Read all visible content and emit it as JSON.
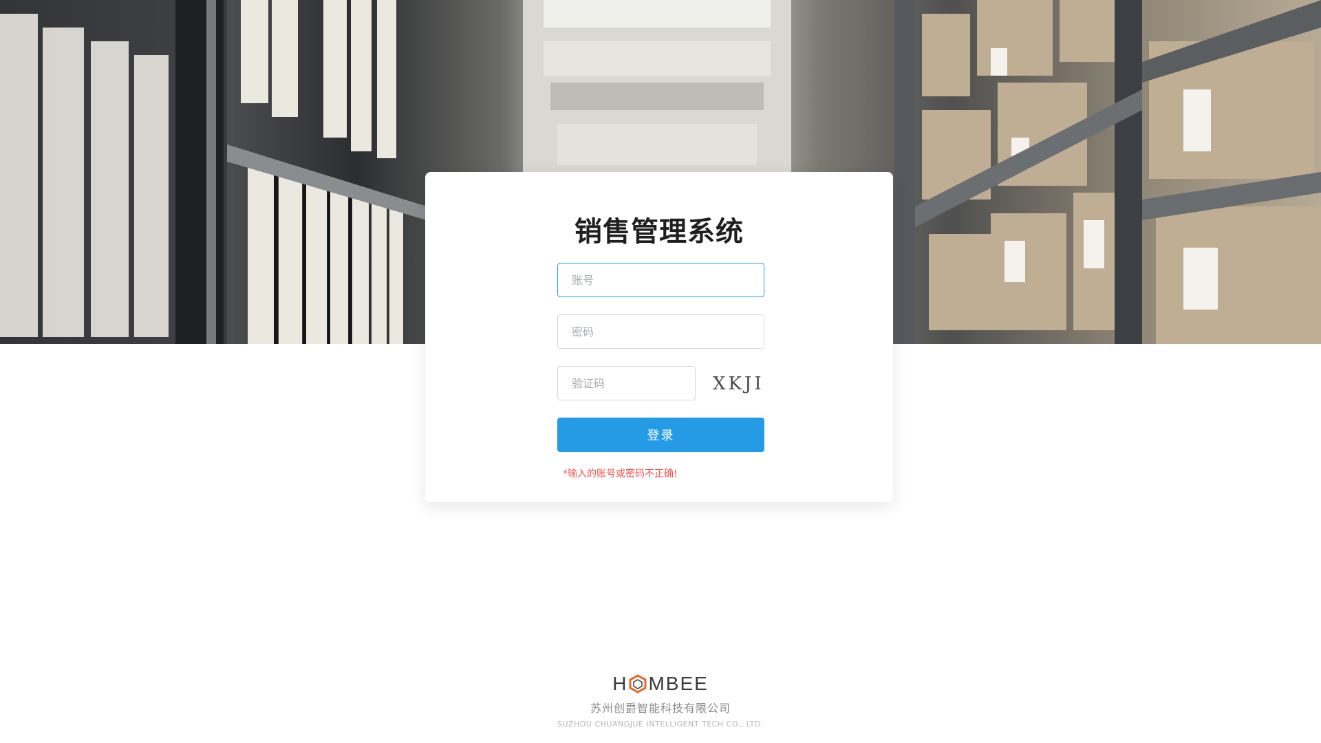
{
  "login": {
    "title": "销售管理系统",
    "account_placeholder": "账号",
    "password_placeholder": "密码",
    "captcha_placeholder": "验证码",
    "captcha_text": "XKJI",
    "submit_label": "登录",
    "error_message": "*输入的账号或密码不正确!"
  },
  "footer": {
    "brand_prefix": "H",
    "brand_suffix": "MBEE",
    "brand_mark_text": "O",
    "company_cn": "苏州创爵智能科技有限公司",
    "company_en": "SUZHOU CHUANGJUE INTELLIGENT TECH CO., LTD."
  },
  "colors": {
    "accent": "#259be6",
    "focus_border": "#2a9ce8",
    "error": "#f0524e",
    "logo_hex": "#e8672a"
  }
}
